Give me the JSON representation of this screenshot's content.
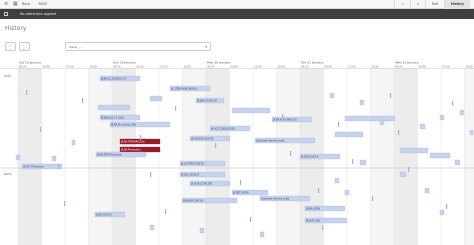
{
  "topbar": {
    "breadcrumb": [
      "Basic",
      "BOSS"
    ],
    "edit_label": "Edit",
    "history_label": "History"
  },
  "toolbar": {
    "selection_status": "No selections applied"
  },
  "page": {
    "title": "History"
  },
  "controls": {
    "btn_left": "« ‹",
    "btn_right": "› »",
    "select_value": "Value_..."
  },
  "timeline": {
    "dates": [
      {
        "label": "Sat 18 January"
      },
      {
        "label": "Sun 19 January"
      },
      {
        "label": "Mon 20 January"
      },
      {
        "label": "Tue 21 January"
      },
      {
        "label": "Wed 22 January"
      }
    ],
    "hours": [
      "00:00",
      "06:00",
      "12:00",
      "18:00"
    ],
    "lanes": [
      {
        "label": "ALTS"
      },
      {
        "label": "ZATS"
      }
    ],
    "colors": {
      "event": "#c7d3ee",
      "event_dark": "#9fb3dc",
      "selected": "#9b1c2b",
      "shade": "#ececec"
    },
    "items": [
      {
        "label": "JE.BA.15.200501 A73"
      },
      {
        "label": "JK_1ZBA.RAN.20006.5"
      },
      {
        "label": "JE.BAS.20100.5A"
      },
      {
        "label": "JE.BAS.JK1.17.2010"
      },
      {
        "label": "JK.BA.Production.200"
      },
      {
        "label": "JK.BA.ALTS.ARA.200"
      },
      {
        "label": "JK.ALTS.20000.3020"
      },
      {
        "label": "JE.BA.TRPSHRGS.Sa"
      },
      {
        "label": "JS.BA.Production"
      },
      {
        "label": "JE.ALT.ALTA.200 2B"
      },
      {
        "label": "Customer Service Lines"
      },
      {
        "label": "JK.BA.TRP Production"
      },
      {
        "label": "JK.ALT. Production"
      },
      {
        "label": "JE.SA.TRP2.CSEI.5A"
      },
      {
        "label": "JK.ALTS.ALTS.A"
      },
      {
        "label": "JK.KEL.20100.5"
      },
      {
        "label": "JE.ALTS.CSTN.200"
      },
      {
        "label": "JE.SET.GATAS"
      },
      {
        "label": "JK.JAALTA.200.5A"
      },
      {
        "label": "Customer Service Lines"
      },
      {
        "label": "JE.BA.ALTAS"
      },
      {
        "label": "JK.BA.200.5A"
      },
      {
        "label": "JE.ALTS.200"
      }
    ]
  }
}
